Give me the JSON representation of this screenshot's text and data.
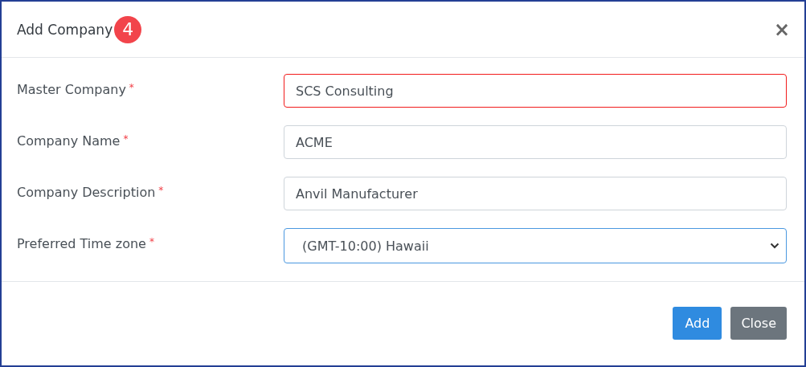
{
  "dialog": {
    "title": "Add Company",
    "badge": "4",
    "close": "×"
  },
  "fields": [
    {
      "label": "Master Company",
      "required": true,
      "kind": "text",
      "value": "SCS Consulting",
      "invalid": true,
      "focused": false
    },
    {
      "label": "Company Name",
      "required": true,
      "kind": "text",
      "value": "ACME",
      "invalid": false,
      "focused": false
    },
    {
      "label": "Company Description",
      "required": true,
      "kind": "text",
      "value": "Anvil Manufacturer",
      "invalid": false,
      "focused": false
    },
    {
      "label": "Preferred Time zone",
      "required": true,
      "kind": "select",
      "value": "(GMT-10:00) Hawaii",
      "invalid": false,
      "focused": true
    }
  ],
  "buttons": [
    {
      "label": "Add",
      "kind": "primary"
    },
    {
      "label": "Close",
      "kind": "secondary"
    }
  ],
  "required_mark": "*"
}
